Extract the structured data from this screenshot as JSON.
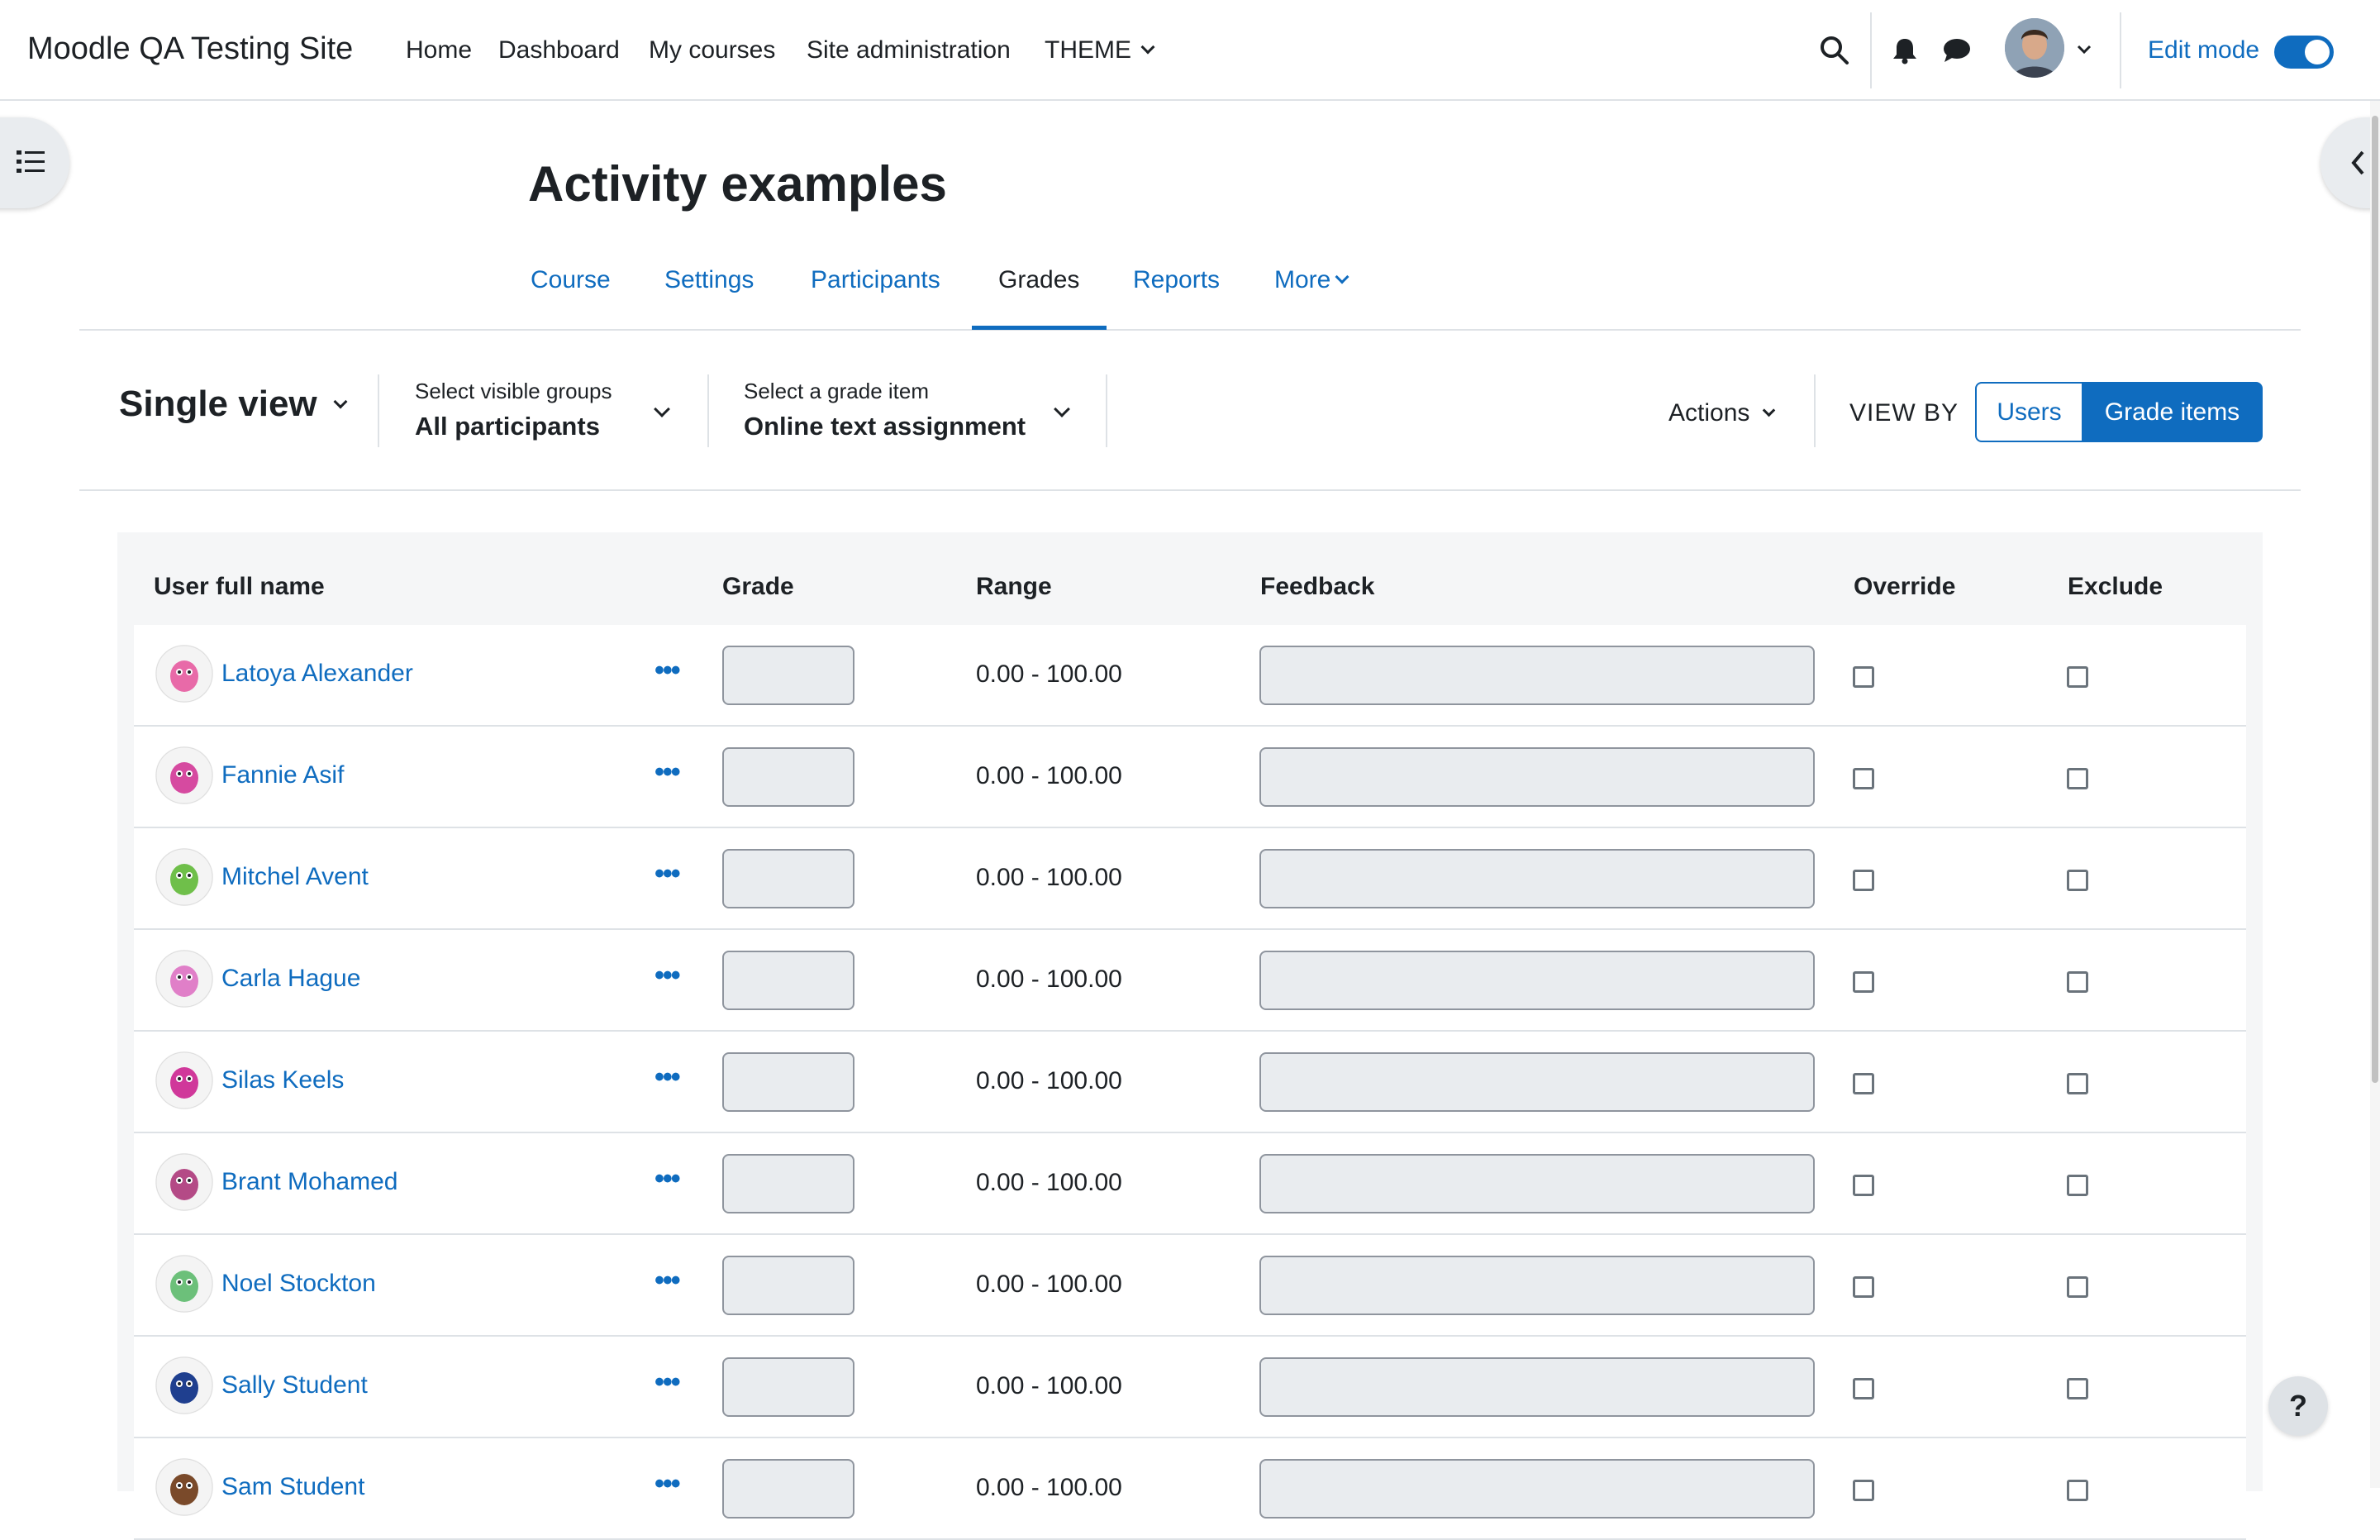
{
  "navbar": {
    "site_name": "Moodle QA Testing Site",
    "items": [
      {
        "label": "Home"
      },
      {
        "label": "Dashboard"
      },
      {
        "label": "My courses"
      },
      {
        "label": "Site administration"
      },
      {
        "label": "THEME"
      }
    ],
    "edit_mode_label": "Edit mode",
    "edit_mode_on": true,
    "icons": [
      "search-icon",
      "bell-icon",
      "chat-icon",
      "user-avatar",
      "chevron-down-icon"
    ]
  },
  "course": {
    "title": "Activity examples",
    "tabs": [
      {
        "label": "Course"
      },
      {
        "label": "Settings"
      },
      {
        "label": "Participants"
      },
      {
        "label": "Grades",
        "active": true
      },
      {
        "label": "Reports"
      },
      {
        "label": "More"
      }
    ]
  },
  "tertiary": {
    "view_label": "Single view",
    "groups": {
      "label": "Select visible groups",
      "value": "All participants"
    },
    "grade_item": {
      "label": "Select a grade item",
      "value": "Online text assignment"
    },
    "actions_label": "Actions",
    "view_by_label": "VIEW BY",
    "view_by_options": [
      {
        "label": "Users",
        "selected": false
      },
      {
        "label": "Grade items",
        "selected": true
      }
    ]
  },
  "table": {
    "headers": {
      "name": "User full name",
      "grade": "Grade",
      "range": "Range",
      "feedback": "Feedback",
      "override": "Override",
      "exclude": "Exclude"
    },
    "rows": [
      {
        "name": "Latoya Alexander",
        "range": "0.00 - 100.00",
        "avatar_color": "#e86aa8"
      },
      {
        "name": "Fannie Asif",
        "range": "0.00 - 100.00",
        "avatar_color": "#d64aa0"
      },
      {
        "name": "Mitchel Avent",
        "range": "0.00 - 100.00",
        "avatar_color": "#6fbf4a"
      },
      {
        "name": "Carla Hague",
        "range": "0.00 - 100.00",
        "avatar_color": "#e07fc8"
      },
      {
        "name": "Silas Keels",
        "range": "0.00 - 100.00",
        "avatar_color": "#d0389a"
      },
      {
        "name": "Brant Mohamed",
        "range": "0.00 - 100.00",
        "avatar_color": "#b44a86"
      },
      {
        "name": "Noel Stockton",
        "range": "0.00 - 100.00",
        "avatar_color": "#6cc07a"
      },
      {
        "name": "Sally Student",
        "range": "0.00 - 100.00",
        "avatar_color": "#1f3f8f"
      },
      {
        "name": "Sam Student",
        "range": "0.00 - 100.00",
        "avatar_color": "#7a4a2a"
      }
    ]
  },
  "help_label": "?",
  "colors": {
    "brand": "#0f6cbf",
    "text": "#1d2125",
    "border": "#dee2e6"
  }
}
